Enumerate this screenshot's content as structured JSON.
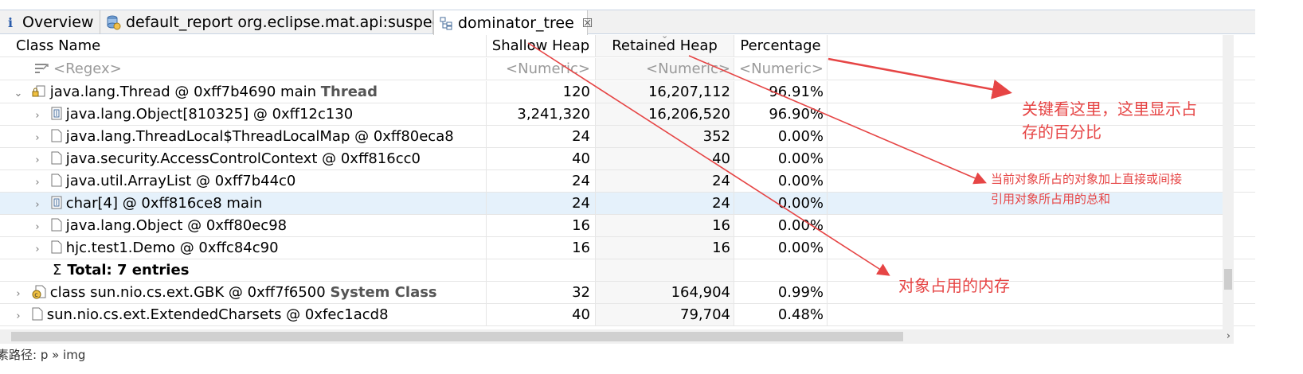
{
  "tabs": [
    {
      "label": "Overview",
      "icon": "info-icon",
      "active": false
    },
    {
      "label": "default_report  org.eclipse.mat.api:suspects",
      "icon": "report-icon",
      "active": false
    },
    {
      "label": "dominator_tree",
      "icon": "tree-icon",
      "active": true,
      "close": "☒"
    }
  ],
  "columns": {
    "class_name": "Class Name",
    "shallow": "Shallow Heap",
    "retained": "Retained Heap",
    "percentage": "Percentage"
  },
  "filter": {
    "name": "<Regex>",
    "shallow": "<Numeric>",
    "retained": "<Numeric>",
    "percentage": "<Numeric>"
  },
  "rows": [
    {
      "name": "java.lang.Thread @ 0xff7b4690  main ",
      "suffix": "Thread",
      "shallow": "120",
      "retained": "16,207,112",
      "percentage": "96.91%"
    },
    {
      "name": "java.lang.Object[810325] @ 0xff12c130",
      "shallow": "3,241,320",
      "retained": "16,206,520",
      "percentage": "96.90%"
    },
    {
      "name": "java.lang.ThreadLocal$ThreadLocalMap @ 0xff80eca8",
      "shallow": "24",
      "retained": "352",
      "percentage": "0.00%"
    },
    {
      "name": "java.security.AccessControlContext @ 0xff816cc0",
      "shallow": "40",
      "retained": "40",
      "percentage": "0.00%"
    },
    {
      "name": "java.util.ArrayList @ 0xff7b44c0",
      "shallow": "24",
      "retained": "24",
      "percentage": "0.00%"
    },
    {
      "name": "char[4] @ 0xff816ce8  main",
      "shallow": "24",
      "retained": "24",
      "percentage": "0.00%"
    },
    {
      "name": "java.lang.Object @ 0xff80ec98",
      "shallow": "16",
      "retained": "16",
      "percentage": "0.00%"
    },
    {
      "name": "hjc.test1.Demo @ 0xffc84c90",
      "shallow": "16",
      "retained": "16",
      "percentage": "0.00%"
    },
    {
      "name": "Total: 7 entries",
      "sigma": "Σ"
    },
    {
      "name": "class sun.nio.cs.ext.GBK @ 0xff7f6500 ",
      "suffix": "System Class",
      "shallow": "32",
      "retained": "164,904",
      "percentage": "0.99%"
    },
    {
      "name": "sun.nio.cs.ext.ExtendedCharsets @ 0xfec1acd8",
      "shallow": "40",
      "retained": "79,704",
      "percentage": "0.48%"
    }
  ],
  "status_bar": "素路径: p » img",
  "annotations": {
    "percentage_line1": "关键看这里，这里显示占",
    "percentage_line2": "存的百分比",
    "retained_line1": "当前对象所占的对象加上直接或间接",
    "retained_line2": "引用对象所占用的总和",
    "shallow": "对象占用的内存"
  },
  "colors": {
    "annotation": "#e64545",
    "selected_row": "#e5f1fb",
    "tab_border": "#c9d4e3"
  }
}
